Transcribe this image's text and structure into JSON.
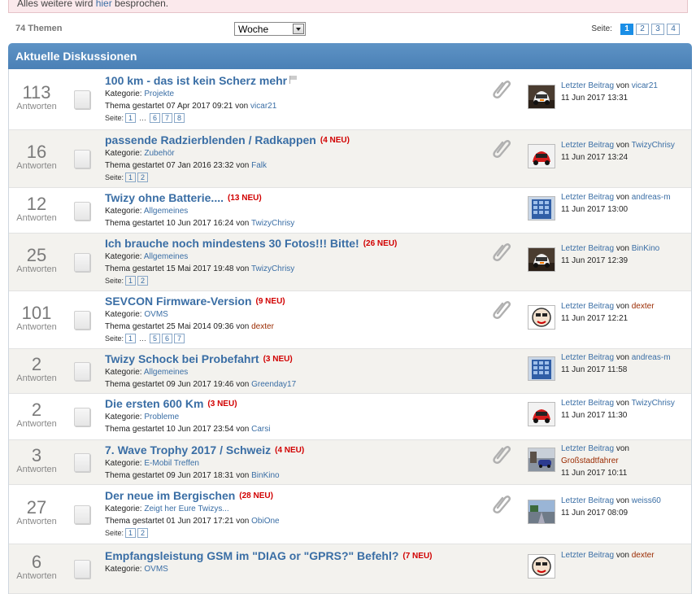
{
  "notice": {
    "pre": "Alles weitere wird ",
    "link": "hier",
    "post": " besprochen."
  },
  "topbar": {
    "count": "74 Themen",
    "filter": "Woche",
    "page_label": "Seite:",
    "pages": [
      "1",
      "2",
      "3",
      "4"
    ],
    "current_page": "1"
  },
  "section_title": "Aktuelle Diskussionen",
  "labels": {
    "replies": "Antworten",
    "category": "Kategorie:",
    "started": "Thema gestartet",
    "by": "von",
    "pages": "Seite:",
    "last_post": "Letzter Beitrag"
  },
  "topics": [
    {
      "replies": "113",
      "title": "100 km - das ist kein Scherz mehr",
      "neu": "",
      "flag": true,
      "category": "Projekte",
      "started": "07 Apr 2017 09:21",
      "author": "vicar21",
      "author_red": false,
      "pages": [
        "1",
        "…",
        "6",
        "7",
        "8"
      ],
      "attachment": true,
      "avatar": "car-white",
      "last_user": "vicar21",
      "last_red": false,
      "last_date": "11 Jun 2017 13:31"
    },
    {
      "replies": "16",
      "title": "passende Radzierblenden / Radkappen",
      "neu": "(4 NEU)",
      "flag": false,
      "category": "Zubehör",
      "started": "07 Jan 2016 23:32",
      "author": "Falk",
      "author_red": false,
      "pages": [
        "1",
        "2"
      ],
      "attachment": true,
      "avatar": "car-red",
      "last_user": "TwizyChrisy",
      "last_red": false,
      "last_date": "11 Jun 2017 13:24"
    },
    {
      "replies": "12",
      "title": "Twizy ohne Batterie....",
      "neu": "(13 NEU)",
      "flag": false,
      "category": "Allgemeines",
      "started": "10 Jun 2017 16:24",
      "author": "TwizyChrisy",
      "author_red": false,
      "pages": [],
      "attachment": false,
      "avatar": "building",
      "last_user": "andreas-m",
      "last_red": false,
      "last_date": "11 Jun 2017 13:00"
    },
    {
      "replies": "25",
      "title": "Ich brauche noch mindestens 30 Fotos!!! Bitte!",
      "neu": "(26 NEU)",
      "flag": false,
      "category": "Allgemeines",
      "started": "15 Mai 2017 19:48",
      "author": "TwizyChrisy",
      "author_red": false,
      "pages": [
        "1",
        "2"
      ],
      "attachment": true,
      "avatar": "car-white",
      "last_user": "BinKino",
      "last_red": false,
      "last_date": "11 Jun 2017 12:39"
    },
    {
      "replies": "101",
      "title": "SEVCON Firmware-Version",
      "neu": "(9 NEU)",
      "flag": false,
      "category": "OVMS",
      "started": "25 Mai 2014 09:36",
      "author": "dexter",
      "author_red": true,
      "pages": [
        "1",
        "…",
        "5",
        "6",
        "7"
      ],
      "attachment": true,
      "avatar": "face",
      "last_user": "dexter",
      "last_red": true,
      "last_date": "11 Jun 2017 12:21"
    },
    {
      "replies": "2",
      "title": "Twizy Schock bei Probefahrt",
      "neu": "(3 NEU)",
      "flag": false,
      "category": "Allgemeines",
      "started": "09 Jun 2017 19:46",
      "author": "Greenday17",
      "author_red": false,
      "pages": [],
      "attachment": false,
      "avatar": "building",
      "last_user": "andreas-m",
      "last_red": false,
      "last_date": "11 Jun 2017 11:58"
    },
    {
      "replies": "2",
      "title": "Die ersten 600 Km",
      "neu": "(3 NEU)",
      "flag": false,
      "category": "Probleme",
      "started": "10 Jun 2017 23:54",
      "author": "Carsi",
      "author_red": false,
      "pages": [],
      "attachment": false,
      "avatar": "car-red",
      "last_user": "TwizyChrisy",
      "last_red": false,
      "last_date": "11 Jun 2017 11:30"
    },
    {
      "replies": "3",
      "title": "7. Wave Trophy 2017 / Schweiz",
      "neu": "(4 NEU)",
      "flag": false,
      "category": "E-Mobil Treffen",
      "started": "09 Jun 2017 18:31",
      "author": "BinKino",
      "author_red": false,
      "pages": [],
      "attachment": true,
      "avatar": "street",
      "last_user": "Großstadtfahrer",
      "last_red": true,
      "last_date": "11 Jun 2017 10:11"
    },
    {
      "replies": "27",
      "title": "Der neue im Bergischen",
      "neu": "(28 NEU)",
      "flag": false,
      "category": "Zeigt her Eure Twizys...",
      "started": "01 Jun 2017 17:21",
      "author": "ObiOne",
      "author_red": false,
      "pages": [
        "1",
        "2"
      ],
      "attachment": true,
      "avatar": "road",
      "last_user": "weiss60",
      "last_red": false,
      "last_date": "11 Jun 2017 08:09"
    },
    {
      "replies": "6",
      "title": "Empfangsleistung GSM im \"DIAG or \"GPRS?\" Befehl?",
      "neu": "(7 NEU)",
      "flag": false,
      "category": "OVMS",
      "started": "",
      "author": "",
      "author_red": false,
      "pages": [],
      "attachment": false,
      "avatar": "face",
      "last_user": "dexter",
      "last_red": true,
      "last_date": ""
    }
  ],
  "colors": {
    "header": "#4a80b6",
    "link": "#3a6ea5",
    "neu": "#d10000",
    "alt_row": "#f3f2ee",
    "page_active": "#1a8ee6"
  }
}
